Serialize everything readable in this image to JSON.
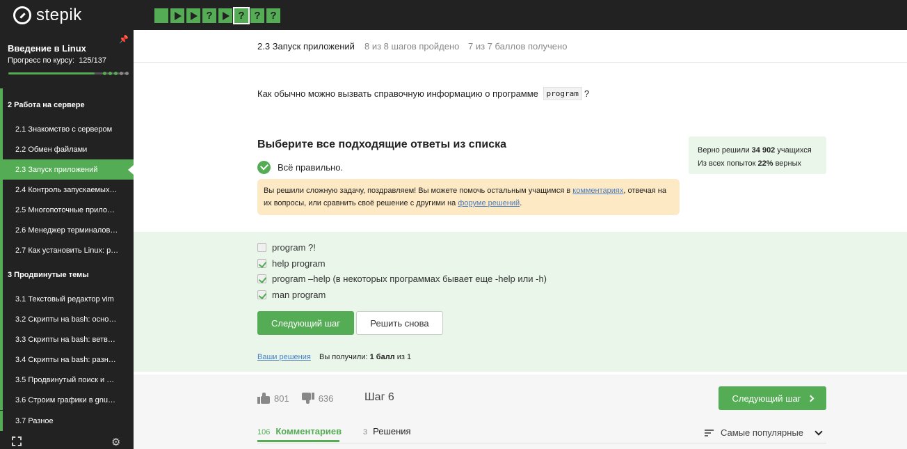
{
  "brand": "stepik",
  "step_bar": {
    "items": [
      {
        "type": "square",
        "label": ""
      },
      {
        "type": "play",
        "label": ""
      },
      {
        "type": "play",
        "label": ""
      },
      {
        "type": "question",
        "label": "?"
      },
      {
        "type": "play",
        "label": ""
      },
      {
        "type": "question",
        "label": "?",
        "current": true
      },
      {
        "type": "question",
        "label": "?"
      },
      {
        "type": "question",
        "label": "?"
      }
    ]
  },
  "sidebar": {
    "course_title": "Введение в Linux",
    "progress_label": "Прогресс по курсу:",
    "progress_value": "125/137",
    "progress_fraction": 0.912,
    "sections": [
      {
        "label": "2  Работа на сервере"
      },
      {
        "label": "3  Продвинутые темы"
      }
    ],
    "lessons": [
      {
        "label": "2.1  Знакомство с сервером"
      },
      {
        "label": "2.2  Обмен файлами"
      },
      {
        "label": "2.3  Запуск приложений"
      },
      {
        "label": "2.4  Контроль запускаемых…"
      },
      {
        "label": "2.5  Многопоточные прило…"
      },
      {
        "label": "2.6  Менеджер терминалов…"
      },
      {
        "label": "2.7  Как установить Linux: р…"
      },
      {
        "label": "3.1  Текстовый редактор vim"
      },
      {
        "label": "3.2  Скрипты на bash: осно…"
      },
      {
        "label": "3.3  Скрипты на bash: ветв…"
      },
      {
        "label": "3.4  Скрипты на bash: разн…"
      },
      {
        "label": "3.5  Продвинутый поиск и …"
      },
      {
        "label": "3.6  Строим графики в gnu…"
      },
      {
        "label": "3.7  Разное"
      }
    ]
  },
  "header": {
    "lesson_title": "2.3 Запуск приложений",
    "steps_done": "8 из 8 шагов пройдено",
    "score": "7 из 7 баллов  получено"
  },
  "question": {
    "before": "Как обычно можно вызвать справочную информацию о программе",
    "code": "program",
    "after": "?"
  },
  "quiz": {
    "title": "Выберите все подходящие ответы из списка",
    "result": "Всё правильно.",
    "congrats_1": "Вы решили сложную задачу, поздравляем! Вы можете помочь остальным учащимся в ",
    "congrats_link1": "комментариях",
    "congrats_2": ", отвечая на их вопросы, или сравнить своё решение с другими на ",
    "congrats_link2": "форуме решений",
    "congrats_3": ".",
    "stats_line1_a": "Верно решили ",
    "stats_line1_b": "34 902",
    "stats_line1_c": " учащихся",
    "stats_line2_a": "Из всех попыток ",
    "stats_line2_b": "22%",
    "stats_line2_c": " верных",
    "options": [
      {
        "label": "program ?!",
        "checked": false
      },
      {
        "label": "help program",
        "checked": true
      },
      {
        "label": "program –help (в некоторых программах бывает еще -help или -h)",
        "checked": true
      },
      {
        "label": "man program",
        "checked": true
      }
    ],
    "next_button": "Следующий шаг",
    "retry_button": "Решить снова",
    "your_solutions": "Ваши решения",
    "you_got_a": "Вы получили: ",
    "you_got_b": "1 балл",
    "you_got_c": " из 1"
  },
  "footer": {
    "likes": "801",
    "dislikes": "636",
    "step_label": "Шаг 6",
    "next_button": "Следующий шаг",
    "tabs": [
      {
        "count": "106",
        "label": "Комментариев"
      },
      {
        "count": "3",
        "label": "Решения"
      }
    ],
    "sort_label": "Самые популярные"
  },
  "colors": {
    "accent": "#54ad54",
    "dark": "#222222",
    "link": "#4a7ec2",
    "congrats_bg": "#fde9c4",
    "answers_bg": "#e9f6e9"
  }
}
